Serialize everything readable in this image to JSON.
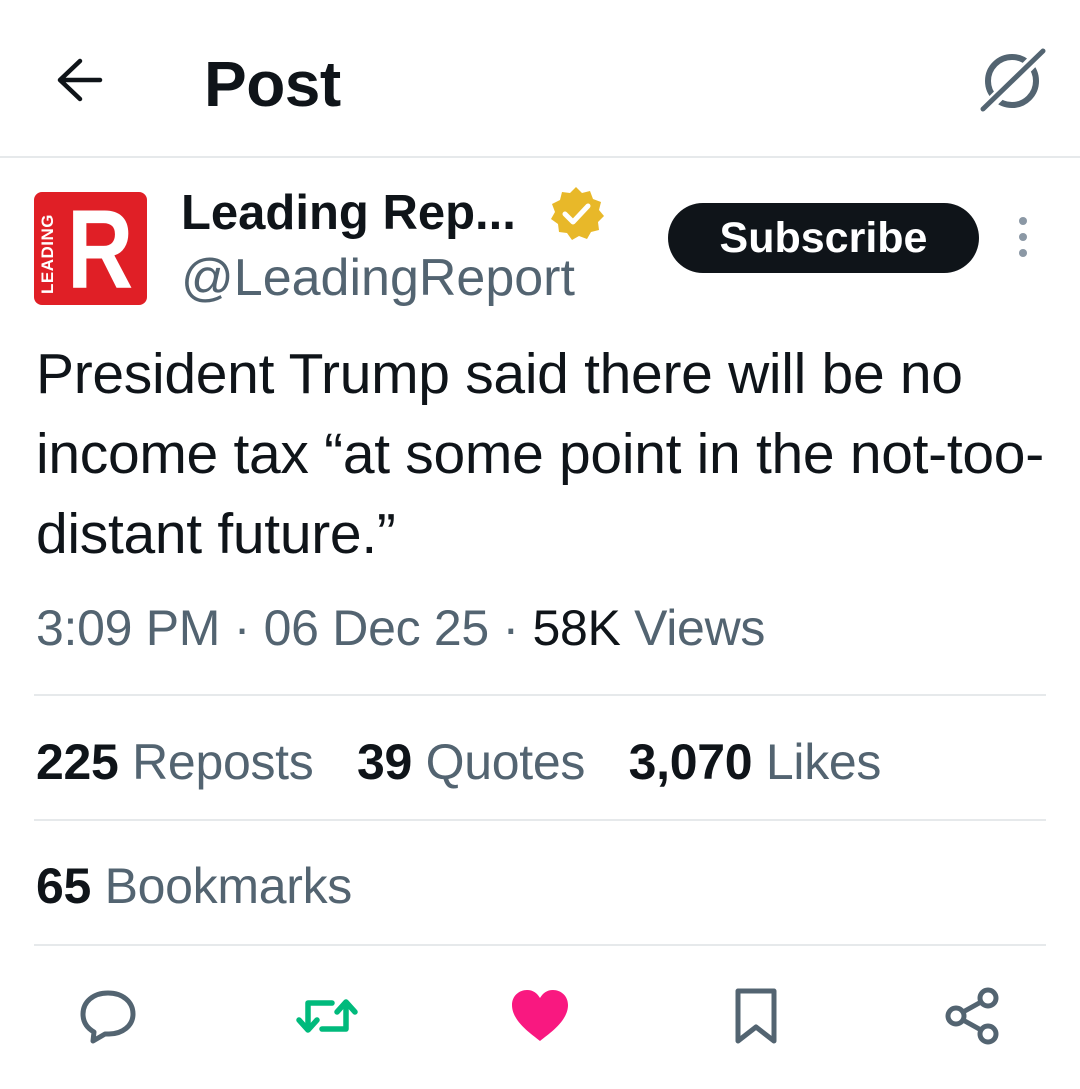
{
  "header": {
    "title": "Post",
    "back_icon": "arrow-left-icon",
    "grok_icon": "grok-icon"
  },
  "author": {
    "name": "Leading Rep...",
    "handle": "@LeadingReport",
    "avatar_letter": "R",
    "avatar_word": "LEADING",
    "avatar_color": "#e01f26",
    "verified_badge_color": "#e8b829"
  },
  "subscribe_label": "Subscribe",
  "tweet": {
    "text": "President Trump said there will be no income tax “at some point in the not-too-distant future.”",
    "time": "3:09 PM",
    "sep": " · ",
    "date": "06 Dec 25",
    "views_count": "58K",
    "views_label": " Views"
  },
  "stats": {
    "reposts_count": "225",
    "reposts_label": " Reposts",
    "quotes_count": "39",
    "quotes_label": " Quotes",
    "likes_count": "3,070",
    "likes_label": " Likes",
    "bookmarks_count": "65",
    "bookmarks_label": " Bookmarks"
  },
  "actions": {
    "reply_icon": "reply-icon",
    "repost_icon": "repost-icon",
    "like_icon": "heart-icon",
    "bookmark_icon": "bookmark-icon",
    "share_icon": "share-icon",
    "repost_color": "#00ba7c",
    "like_color": "#f91880",
    "icon_color": "#536471"
  }
}
